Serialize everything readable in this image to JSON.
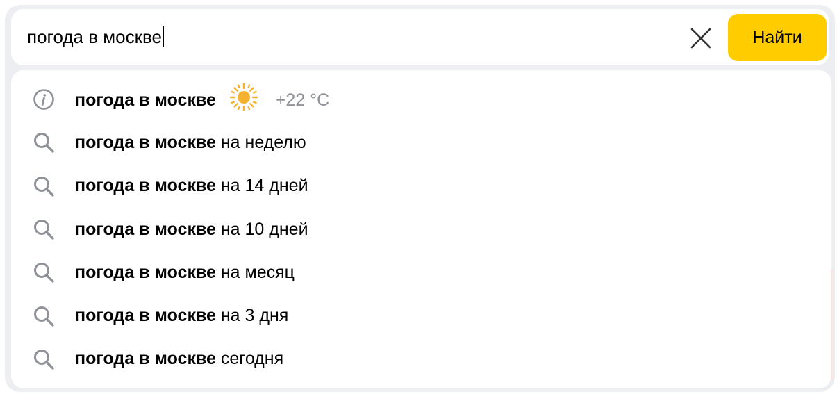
{
  "search": {
    "query": "погода в москве",
    "submit_label": "Найти"
  },
  "suggestions": [
    {
      "icon": "info-icon",
      "bold": "погода в москве",
      "rest": "",
      "weather": {
        "icon": "sun-icon",
        "temp": "+22 °C"
      }
    },
    {
      "icon": "search-icon",
      "bold": "погода в москве",
      "rest": "на неделю"
    },
    {
      "icon": "search-icon",
      "bold": "погода в москве",
      "rest": "на 14 дней"
    },
    {
      "icon": "search-icon",
      "bold": "погода в москве",
      "rest": "на 10 дней"
    },
    {
      "icon": "search-icon",
      "bold": "погода в москве",
      "rest": "на месяц"
    },
    {
      "icon": "search-icon",
      "bold": "погода в москве",
      "rest": "на 3 дня"
    },
    {
      "icon": "search-icon",
      "bold": "погода в москве",
      "rest": "сегодня"
    }
  ],
  "colors": {
    "accent": "#ffcc00",
    "frame": "#eceef2",
    "icon_gray": "#8f9399",
    "sun": "#f5b230"
  }
}
